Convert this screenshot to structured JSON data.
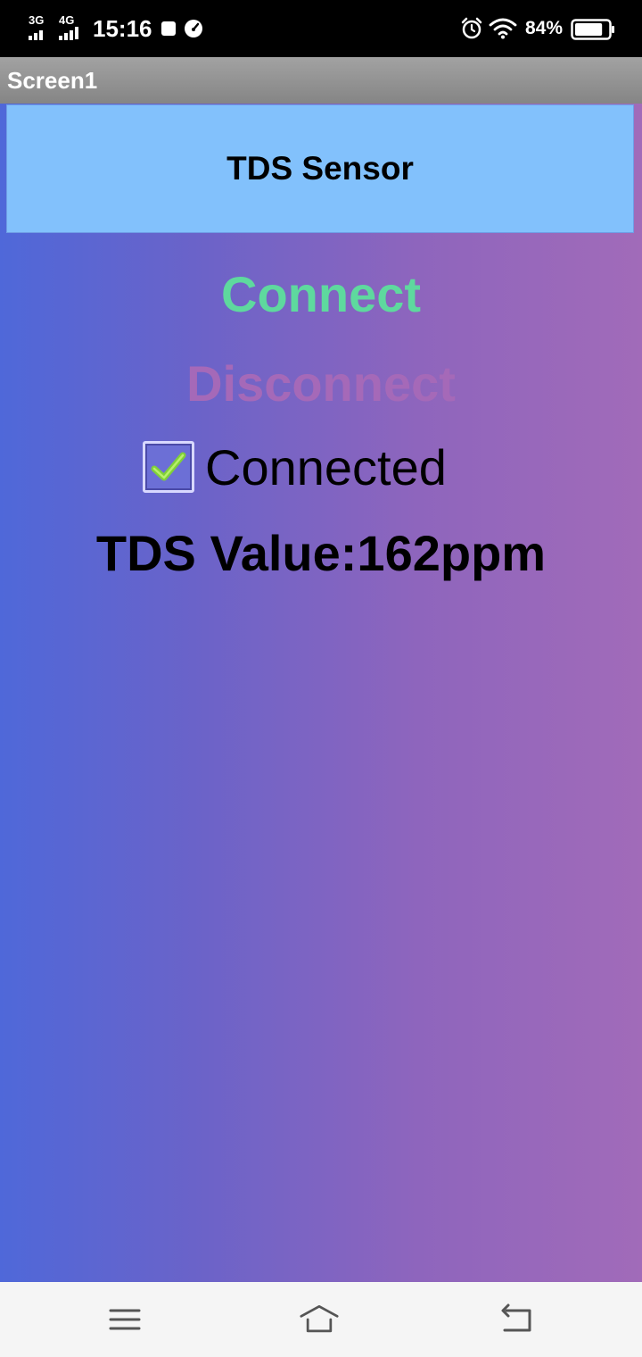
{
  "status_bar": {
    "network_1": "3G",
    "network_2": "4G",
    "time": "15:16",
    "battery_percent": "84%",
    "icons": [
      "signal-3g-icon",
      "signal-4g-icon",
      "stop-square-icon",
      "speed-gauge-icon",
      "alarm-icon",
      "wifi-icon",
      "battery-icon"
    ],
    "battery_level": 0.84
  },
  "title_bar": {
    "title": "Screen1"
  },
  "app": {
    "header": "TDS Sensor",
    "connect_label": "Connect",
    "disconnect_label": "Disconnect",
    "connected_checkbox": {
      "label": "Connected",
      "checked": true
    },
    "tds_value": "TDS Value:162ppm",
    "colors": {
      "header_bg": "#82c1fc",
      "connect": "#5ed99e",
      "disconnect": "#a569b8",
      "gradient_left": "#4f68d9",
      "gradient_right": "#a16bb9"
    }
  },
  "nav_bar": {
    "buttons": [
      "menu-icon",
      "home-icon",
      "back-icon"
    ]
  }
}
